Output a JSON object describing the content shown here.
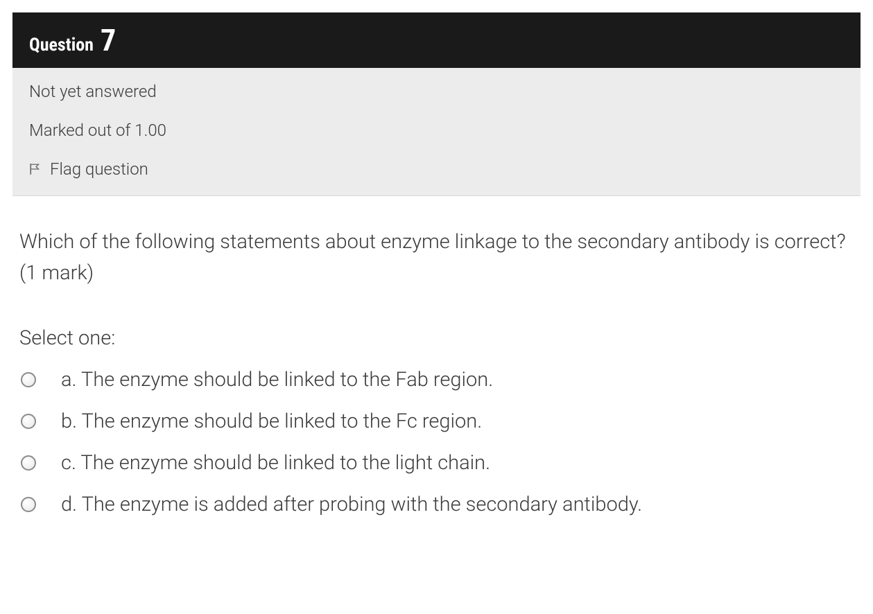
{
  "header": {
    "question_label": "Question",
    "question_number": "7"
  },
  "meta": {
    "status": "Not yet answered",
    "marks": "Marked out of 1.00",
    "flag_label": "Flag question"
  },
  "content": {
    "question_text": "Which of the following statements about enzyme linkage to the secondary antibody is correct? (1 mark)",
    "select_prompt": "Select one:",
    "options": [
      {
        "letter": "a.",
        "text": "The enzyme should be linked to the Fab region."
      },
      {
        "letter": "b.",
        "text": "The enzyme should be linked to the Fc region."
      },
      {
        "letter": "c.",
        "text": "The enzyme should be linked to the light chain."
      },
      {
        "letter": "d.",
        "text": "The enzyme is added after probing with the secondary antibody."
      }
    ]
  }
}
